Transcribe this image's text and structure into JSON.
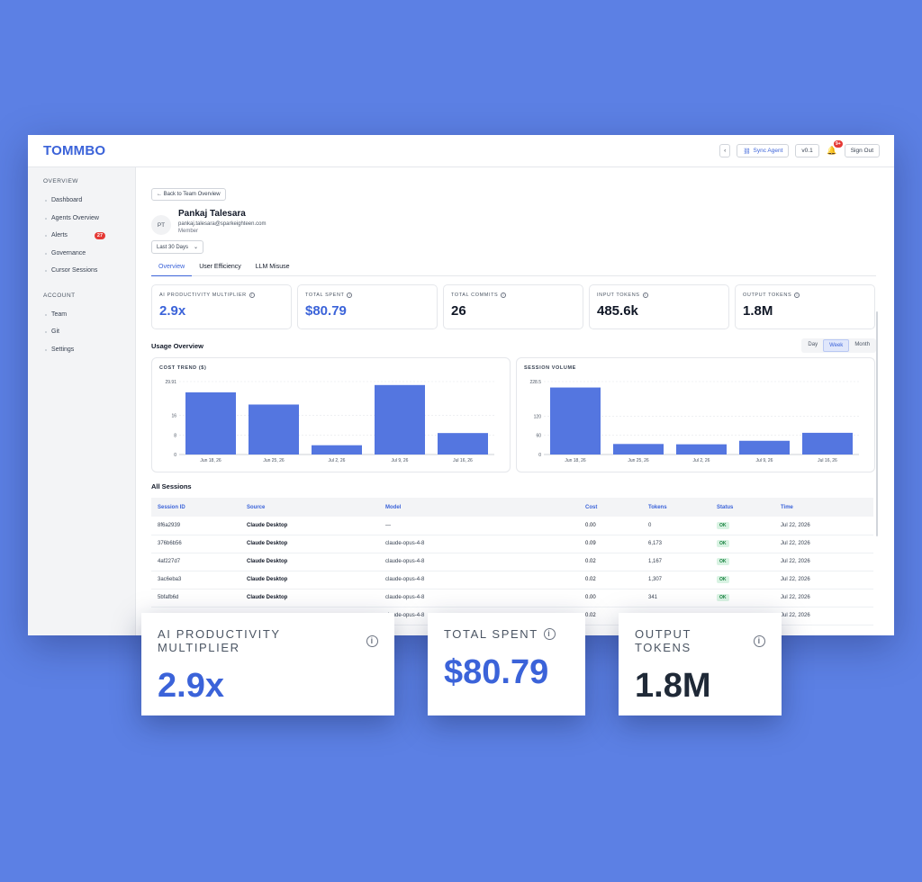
{
  "app": {
    "logo": "TOMMBO",
    "back_chevron": "‹",
    "sync_label": "Sync Agent",
    "version": "v0.1",
    "notif_count": "9+",
    "signout_label": "Sign Out"
  },
  "sidebar": {
    "section1": "OVERVIEW",
    "items1": [
      {
        "label": "Dashboard"
      },
      {
        "label": "Agents Overview"
      },
      {
        "label": "Alerts",
        "badge": "27"
      },
      {
        "label": "Governance"
      },
      {
        "label": "Cursor Sessions"
      }
    ],
    "section2": "ACCOUNT",
    "items2": [
      {
        "label": "Team"
      },
      {
        "label": "Git"
      },
      {
        "label": "Settings"
      }
    ]
  },
  "page": {
    "back_label": "← Back to Team Overview",
    "avatar_initials": "PT",
    "name": "Pankaj Talesara",
    "email": "pankaj.talesara@sparkeighteen.com",
    "role": "Member",
    "range": "Last 30 Days",
    "tabs": [
      "Overview",
      "User Efficiency",
      "LLM Misuse"
    ]
  },
  "metrics": [
    {
      "label": "AI PRODUCTIVITY MULTIPLIER",
      "value": "2.9x"
    },
    {
      "label": "TOTAL SPENT",
      "value": "$80.79"
    },
    {
      "label": "TOTAL COMMITS",
      "value": "26"
    },
    {
      "label": "INPUT TOKENS",
      "value": "485.6k"
    },
    {
      "label": "OUTPUT TOKENS",
      "value": "1.8M"
    }
  ],
  "usage": {
    "title": "Usage Overview",
    "periods": [
      "Day",
      "Week",
      "Month"
    ],
    "active_period": "Week"
  },
  "chart_data": [
    {
      "type": "bar",
      "title": "COST TREND ($)",
      "categories": [
        "Jun 18, 26",
        "Jun 25, 26",
        "Jul 2, 26",
        "Jul 9, 26",
        "Jul 16, 26"
      ],
      "values": [
        25.5,
        20.5,
        3.8,
        28.5,
        8.8
      ],
      "ylim": [
        0,
        29.91
      ],
      "yticks": [
        "0",
        "8",
        "16",
        "29.91"
      ],
      "color": "#5476e0"
    },
    {
      "type": "bar",
      "title": "SESSION VOLUME",
      "categories": [
        "Jun 18, 26",
        "Jun 25, 26",
        "Jul 2, 26",
        "Jul 9, 26",
        "Jul 16, 26"
      ],
      "values": [
        210,
        33,
        32,
        43,
        68
      ],
      "ylim": [
        0,
        228.5
      ],
      "yticks": [
        "0",
        "60",
        "120",
        "228.5"
      ],
      "color": "#5476e0"
    }
  ],
  "sessions": {
    "title": "All Sessions",
    "columns": [
      "Session ID",
      "Source",
      "Model",
      "Cost",
      "Tokens",
      "Status",
      "Time"
    ],
    "rows": [
      [
        "8f6a2939",
        "Claude Desktop",
        "—",
        "0.00",
        "0",
        "OK",
        "Jul 22, 2026"
      ],
      [
        "376b6b56",
        "Claude Desktop",
        "claude-opus-4-8",
        "0.09",
        "6,173",
        "OK",
        "Jul 22, 2026"
      ],
      [
        "4af227d7",
        "Claude Desktop",
        "claude-opus-4-8",
        "0.02",
        "1,167",
        "OK",
        "Jul 22, 2026"
      ],
      [
        "3ac6eba3",
        "Claude Desktop",
        "claude-opus-4-8",
        "0.02",
        "1,307",
        "OK",
        "Jul 22, 2026"
      ],
      [
        "5bfafb6d",
        "Claude Desktop",
        "claude-opus-4-8",
        "0.00",
        "341",
        "OK",
        "Jul 22, 2026"
      ],
      [
        "",
        "",
        "claude-opus-4-8",
        "0.02",
        "",
        "",
        "Jul 22, 2026"
      ]
    ]
  },
  "zoom_cards": [
    {
      "label": "AI PRODUCTIVITY MULTIPLIER",
      "value": "2.9x"
    },
    {
      "label": "TOTAL SPENT",
      "value": "$80.79"
    },
    {
      "label": "OUTPUT TOKENS",
      "value": "1.8M"
    }
  ]
}
